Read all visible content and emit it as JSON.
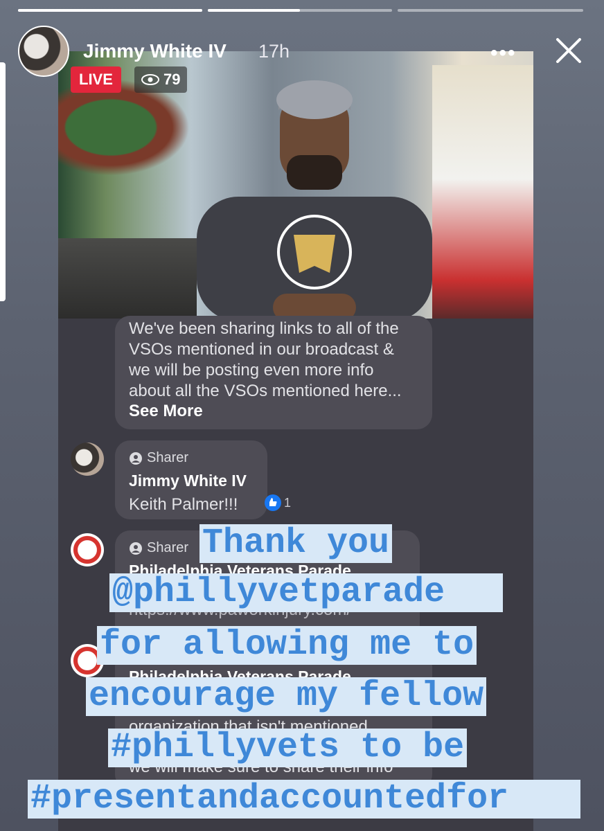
{
  "story": {
    "progress": [
      {
        "fill": 1.0
      },
      {
        "fill": 0.5
      },
      {
        "fill": 0.0
      }
    ],
    "user_name": "Jimmy White IV",
    "time_ago": "17h",
    "menu_icon": "more-dots-icon",
    "close_icon": "close-icon"
  },
  "live_video": {
    "live_label": "LIVE",
    "viewer_count": "79",
    "viewer_icon": "eye-icon"
  },
  "comments": {
    "first": {
      "lines": [
        "We've been sharing links to all of the",
        "VSOs mentioned in our broadcast &",
        "we will be posting even more info",
        "about all the VSOs mentioned here..."
      ],
      "see_more": "See More"
    },
    "second": {
      "badge": "Sharer",
      "name": "Jimmy White IV",
      "text": "Keith Palmer!!!",
      "like_count": "1"
    },
    "third": {
      "badge": "Sharer",
      "name": "Philadelphia Veterans Parade",
      "text": "https://www.paworkinjury.com/"
    },
    "fourth": {
      "name": "Philadelphia Veterans Parade",
      "line1": "organization that isn't mentioned",
      "line2": "we will make sure to share their info"
    }
  },
  "caption": {
    "line1": "Thank you",
    "line2": "@phillyvetparade",
    "line3": "for allowing me to",
    "line4": "encourage my fellow",
    "line5": "#phillyvets to be",
    "line6": "#presentandaccountedfor"
  },
  "colors": {
    "caption_text": "#3f88d8",
    "caption_bg": "#d8e8f7",
    "live_red": "#e3263c",
    "like_blue": "#1877f2"
  }
}
